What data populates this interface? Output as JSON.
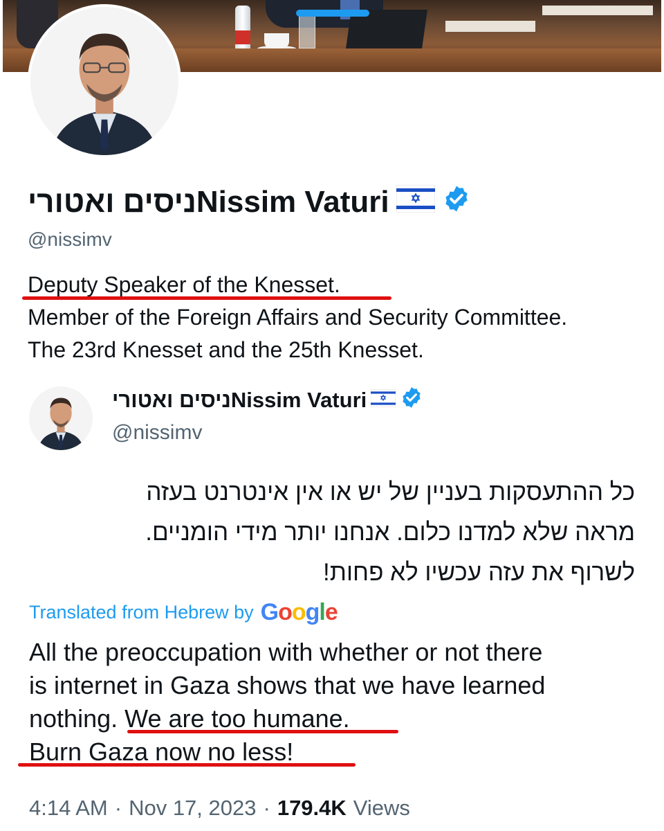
{
  "profile": {
    "display_name": "ניסים ואטוריNissim Vaturi",
    "handle": "@nissimv",
    "flag_icon": "israel-flag-icon",
    "verified_icon": "verified-badge-icon",
    "bio_lines": [
      "Deputy Speaker of the Knesset.",
      "Member of the Foreign Affairs and Security Committee.",
      "The 23rd Knesset and the 25th Knesset."
    ]
  },
  "tweet": {
    "display_name": "ניסים ואטוריNissim Vaturi",
    "handle": "@nissimv",
    "hebrew_lines": [
      "כל ההתעסקות בעניין של יש או אין אינטרנט בעזה",
      "מראה שלא למדנו כלום. אנחנו יותר מידי הומניים.",
      "לשרוף את עזה עכשיו לא פחות!"
    ],
    "translated_label": "Translated from Hebrew by",
    "translator": "Google",
    "translation_lines": [
      "All the preoccupation with whether or not there",
      "is internet in Gaza shows that we have learned",
      "nothing. We are too humane.",
      "Burn Gaza now no less!"
    ],
    "time": "4:14 AM",
    "separator": "·",
    "date": "Nov 17, 2023",
    "views_count": "179.4K",
    "views_label": "Views"
  },
  "colors": {
    "accent": "#1d9bf0",
    "underline": "#e01010",
    "muted": "#536471"
  }
}
